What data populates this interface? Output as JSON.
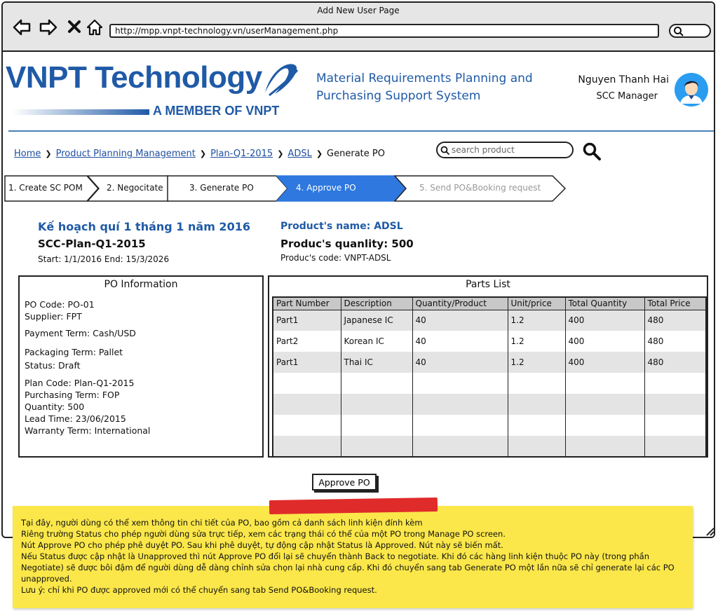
{
  "browser": {
    "title": "Add New User Page",
    "url": "http://mpp.vnpt-technology.vn/userManagement.php"
  },
  "header": {
    "logo_text": "VNPT Technology",
    "logo_sub": "A MEMBER OF VNPT",
    "system_title_1": "Material Requirements Planning and",
    "system_title_2": "Purchasing Support System",
    "user_name": "Nguyen Thanh Hai",
    "user_role": "SCC Manager",
    "accent_color": "#1f5aa6"
  },
  "breadcrumb": {
    "items": [
      "Home",
      "Product Planning Management",
      "Plan-Q1-2015",
      "ADSL"
    ],
    "current": "Generate PO"
  },
  "search": {
    "placeholder": "search product"
  },
  "steps": [
    {
      "label": "1. Create SC POM",
      "state": "done"
    },
    {
      "label": "2. Negocitate",
      "state": "done"
    },
    {
      "label": "3. Generate PO",
      "state": "done"
    },
    {
      "label": "4. Approve PO",
      "state": "active"
    },
    {
      "label": "5. Send PO&Booking request",
      "state": "disabled"
    }
  ],
  "plan": {
    "title": "Kế hoạch quí 1 tháng 1 năm 2016",
    "code": "SCC-Plan-Q1-2015",
    "dates": "Start: 1/1/2016 End: 15/3/2026"
  },
  "product": {
    "name": "Product's name: ADSL",
    "quantity": "Produc's quanlity: 500",
    "code": "Produc's code: VNPT-ADSL"
  },
  "po_info": {
    "title": "PO Information",
    "po_code": "PO Code: PO-01",
    "supplier": "Supplier: FPT",
    "payment_term": "Payment Term: Cash/USD",
    "packaging_term": "Packaging Term: Pallet",
    "status": "Status: Draft",
    "plan_code": "Plan Code: Plan-Q1-2015",
    "purchasing_term": "Purchasing Term: FOP",
    "quantity": "Quantity: 500",
    "lead_time": "Lead Time: 23/06/2015",
    "warranty_term": "Warranty Term: International"
  },
  "parts": {
    "title": "Parts List",
    "columns": [
      "Part Number",
      "Description",
      "Quantity/Product",
      "Unit/price",
      "Total Quantity",
      "Total Price"
    ],
    "rows": [
      [
        "Part1",
        "Japanese IC",
        "40",
        "1.2",
        "400",
        "480"
      ],
      [
        "Part2",
        "Korean IC",
        "40",
        "1.2",
        "400",
        "480"
      ],
      [
        "Part1",
        "Thai IC",
        "40",
        "1.2",
        "400",
        "480"
      ],
      [
        "",
        "",
        "",
        "",
        "",
        ""
      ],
      [
        "",
        "",
        "",
        "",
        "",
        ""
      ],
      [
        "",
        "",
        "",
        "",
        "",
        ""
      ],
      [
        "",
        "",
        "",
        "",
        "",
        ""
      ]
    ]
  },
  "actions": {
    "approve_label": "Approve PO"
  },
  "note": {
    "lines": [
      "Tại đây, người dùng có thể xem thông tin chi tiết của PO, bao gồm cả danh sách linh kiện đính kèm",
      "Riêng trường Status cho phép người dùng sửa trực tiếp, xem các trạng thái có thể của một PO trong Manage PO screen.",
      "Nút Approve PO cho phép phê duyệt PO. Sau khi phê duyệt, tự động cập nhật Status là Approved. Nút này sẽ biến mất.",
      "Nếu Status được cập nhật là Unapproved thì nút Approve PO đổi lại sẽ chuyển thành Back to negotiate. Khi đó các hàng linh kiện thuộc PO này (trong phần Negotiate) sẽ được bôi đậm để người dùng dễ dàng chỉnh sửa chọn lại nhà cung cấp. Khi đó chuyển sang tab Generate PO một lần nữa sẽ chỉ generate lại các PO unapproved.",
      "Lưu ý: chỉ khi PO được approved mới có thể chuyển sang tab Send PO&Booking request."
    ]
  }
}
